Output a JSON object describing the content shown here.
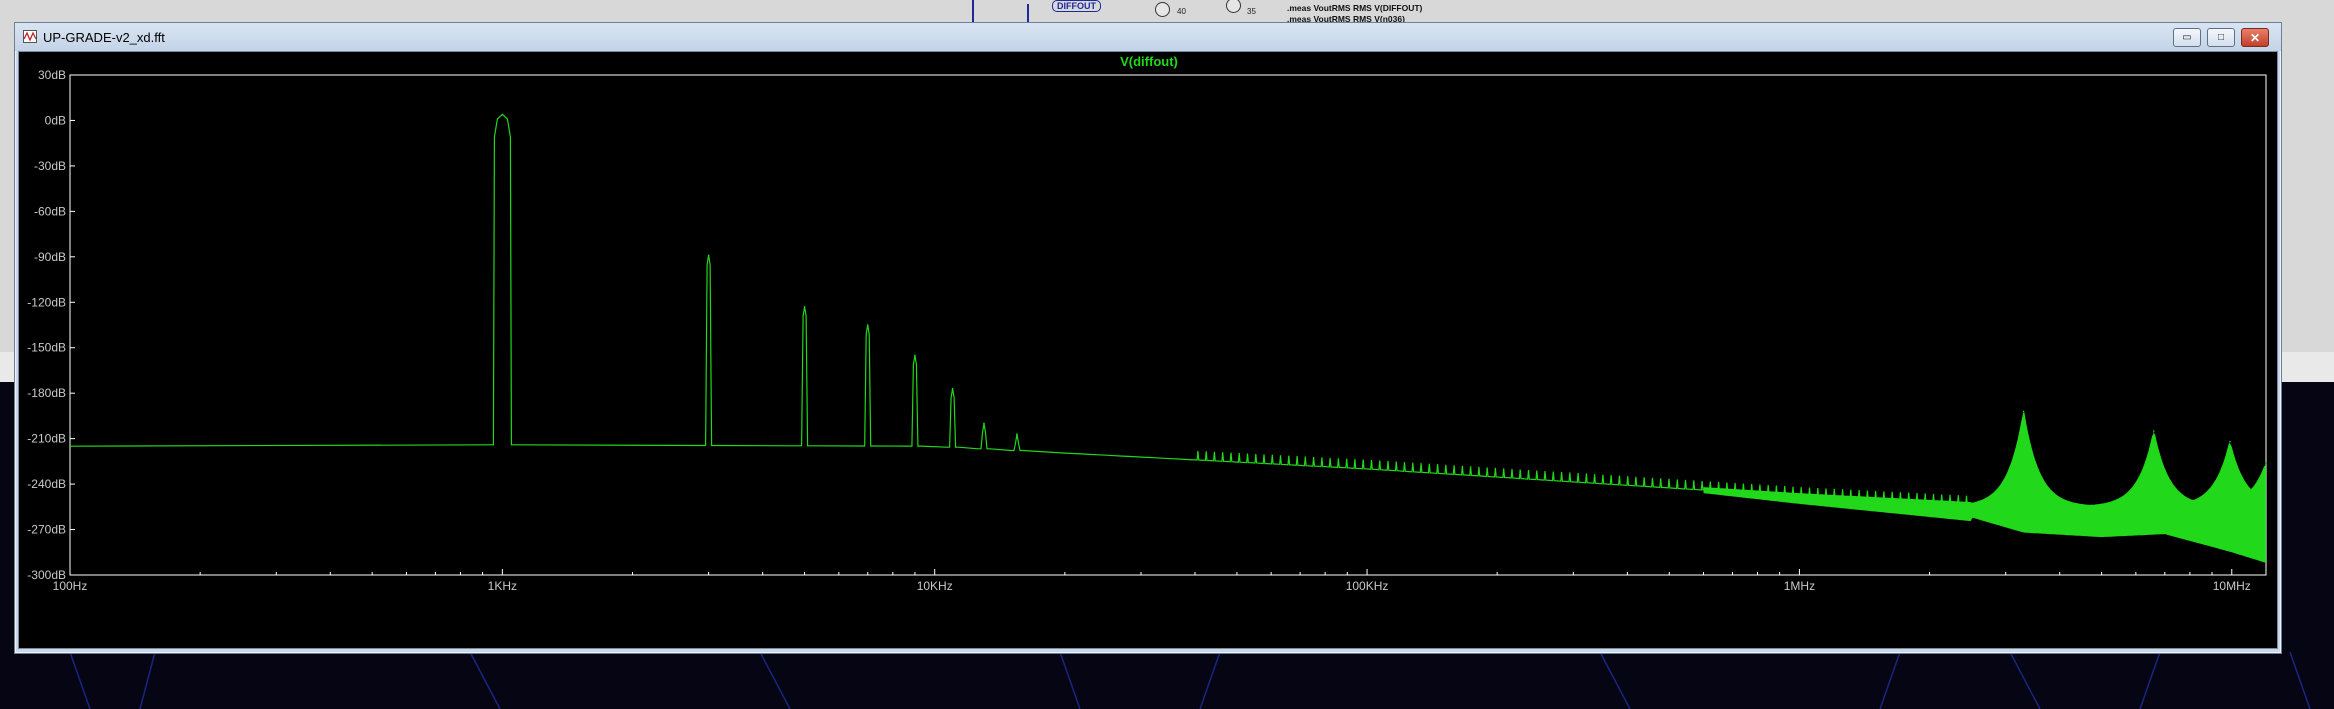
{
  "window": {
    "title": "UP-GRADE-v2_xd.fft",
    "minimize_glyph": "▭",
    "maximize_glyph": "□",
    "close_glyph": "✕"
  },
  "background_schematic": {
    "net_label": "DIFFOUT",
    "pin_numbers": [
      "40",
      "35"
    ],
    "spice_directives": [
      ".meas VoutRMS RMS V(DIFFOUT)",
      ".meas VoutRMS RMS V(n036)"
    ]
  },
  "plot": {
    "trace_name": "V(diffout)",
    "trace_color": "#21d81a",
    "axis_color": "#ffffff",
    "background_color": "#000000"
  },
  "chart_data": {
    "type": "line",
    "title": "V(diffout)",
    "xscale": "log",
    "xlim": [
      100,
      12000000
    ],
    "ylim": [
      -300,
      30
    ],
    "x_ticks": [
      "100Hz",
      "1KHz",
      "10KHz",
      "100KHz",
      "1MHz",
      "10MHz"
    ],
    "y_ticks": [
      "30dB",
      "0dB",
      "-30dB",
      "-60dB",
      "-90dB",
      "-120dB",
      "-150dB",
      "-180dB",
      "-210dB",
      "-240dB",
      "-270dB",
      "-300dB"
    ],
    "grid": false,
    "noise_floor": {
      "points": [
        [
          100,
          -215
        ],
        [
          900,
          -214
        ],
        [
          10000,
          -215
        ],
        [
          100000,
          -230
        ],
        [
          1000000,
          -248
        ],
        [
          3000000,
          -255
        ]
      ]
    },
    "harmonic_peaks": [
      {
        "x": 1000,
        "y": 4
      },
      {
        "x": 3000,
        "y": -89
      },
      {
        "x": 5000,
        "y": -123
      },
      {
        "x": 7000,
        "y": -135
      },
      {
        "x": 9000,
        "y": -155
      },
      {
        "x": 11000,
        "y": -177
      },
      {
        "x": 13000,
        "y": -200
      },
      {
        "x": 15500,
        "y": -207
      }
    ],
    "hf_peaks": [
      {
        "x": 3300000,
        "y": -192
      },
      {
        "x": 6600000,
        "y": -205
      },
      {
        "x": 9900000,
        "y": -212
      },
      {
        "x": 12000000,
        "y": -226
      }
    ],
    "hf_band_bottom": [
      [
        2500000,
        -262
      ],
      [
        3300000,
        -272
      ],
      [
        5000000,
        -275
      ],
      [
        7000000,
        -273
      ],
      [
        10000000,
        -285
      ],
      [
        12000000,
        -292
      ]
    ]
  }
}
